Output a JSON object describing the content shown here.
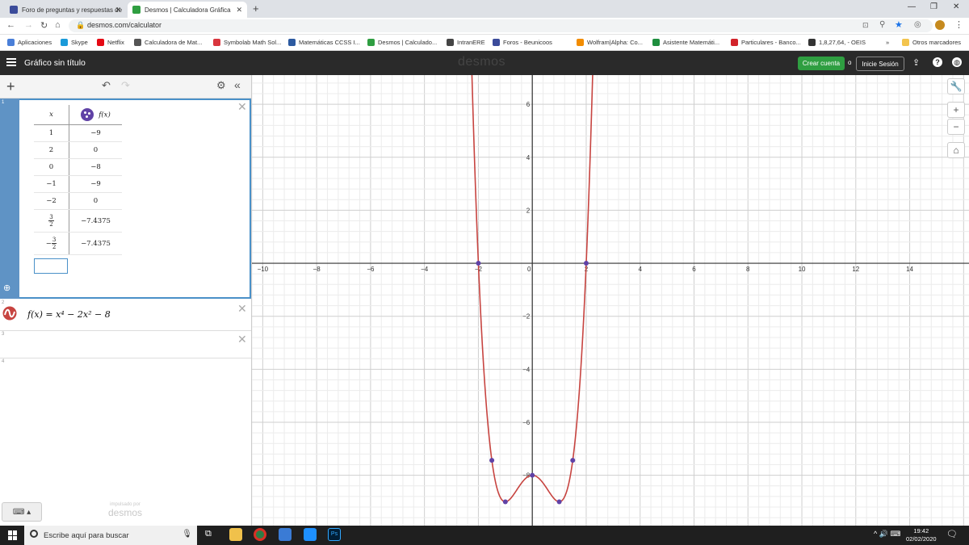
{
  "browser": {
    "tabs": [
      {
        "label": "Foro de preguntas y respuestas de",
        "icon": "forum-icon",
        "color": "#3b4b9a"
      },
      {
        "label": "Desmos | Calculadora Gráfica",
        "icon": "desmos-icon",
        "color": "#2f9e41"
      }
    ],
    "url": "desmos.com/calculator",
    "bookmarks": [
      {
        "label": "Aplicaciones",
        "color": "#4a7fd8"
      },
      {
        "label": "Skype",
        "color": "#1a9ad9"
      },
      {
        "label": "Netflix",
        "color": "#e50914"
      },
      {
        "label": "Calculadora de Mat...",
        "color": "#555555"
      },
      {
        "label": "Symbolab Math Sol...",
        "color": "#d9363e"
      },
      {
        "label": "Matemáticas CCSS I...",
        "color": "#2c5aa0"
      },
      {
        "label": "Desmos | Calculado...",
        "color": "#2f9e41"
      },
      {
        "label": "IntranERE",
        "color": "#444444"
      },
      {
        "label": "Foros - Beunicoos",
        "color": "#3b4b9a"
      },
      {
        "label": "Wolfram|Alpha: Co...",
        "color": "#f28c00"
      },
      {
        "label": "Asistente Matemáti...",
        "color": "#1e8e3e"
      },
      {
        "label": "Particulares - Banco...",
        "color": "#d2232a"
      },
      {
        "label": "1,8,27,64, - OEIS",
        "color": "#333333"
      }
    ],
    "bookmarks_more": "»",
    "other_bookmarks": "Otros marcadores"
  },
  "desmos": {
    "graph_title": "Gráfico sin título",
    "logo": "desmos",
    "create_account": "Crear cuenta",
    "or": "o",
    "sign_in": "Inicie Sesión",
    "accent": "#2f9e41",
    "powered_by": "impulsado por",
    "powered_logo": "desmos"
  },
  "expressions": {
    "table": {
      "index": "1",
      "header_x": "x",
      "header_y": "f(x)",
      "rows": [
        {
          "x": "1",
          "y": "−9"
        },
        {
          "x": "2",
          "y": "0"
        },
        {
          "x": "0",
          "y": "−8"
        },
        {
          "x": "−1",
          "y": "−9"
        },
        {
          "x": "−2",
          "y": "0"
        },
        {
          "x_num": "3",
          "x_den": "2",
          "x_sign": "",
          "y": "−7.4375"
        },
        {
          "x_num": "3",
          "x_den": "2",
          "x_sign": "−",
          "y": "−7.4375"
        }
      ]
    },
    "expr2": {
      "index": "2",
      "latex_text": "f(x) = x⁴ − 2x² − 8",
      "color": "#c74440"
    },
    "expr3": {
      "index": "3"
    },
    "expr4": {
      "index": "4"
    }
  },
  "chart_data": {
    "type": "line",
    "function": "f(x) = x^4 - 2x^2 - 8",
    "xlim": [
      -10.4,
      16.2
    ],
    "ylim": [
      -9.9,
      7.1
    ],
    "x_ticks": [
      -10,
      -8,
      -6,
      -4,
      -2,
      0,
      2,
      4,
      6,
      8,
      10,
      12,
      14
    ],
    "y_ticks": [
      -8,
      -6,
      -4,
      -2,
      2,
      4,
      6
    ],
    "grid": true,
    "series": [
      {
        "color": "#c74440",
        "points": []
      }
    ],
    "points": [
      {
        "x": 1,
        "y": -9
      },
      {
        "x": 2,
        "y": 0
      },
      {
        "x": 0,
        "y": -8
      },
      {
        "x": -1,
        "y": -9
      },
      {
        "x": -2,
        "y": 0
      },
      {
        "x": 1.5,
        "y": -7.4375
      },
      {
        "x": -1.5,
        "y": -7.4375
      }
    ],
    "point_color": "#6042a6"
  },
  "taskbar": {
    "search_placeholder": "Escribe aquí para buscar",
    "time": "19:42",
    "date": "02/02/2020"
  }
}
